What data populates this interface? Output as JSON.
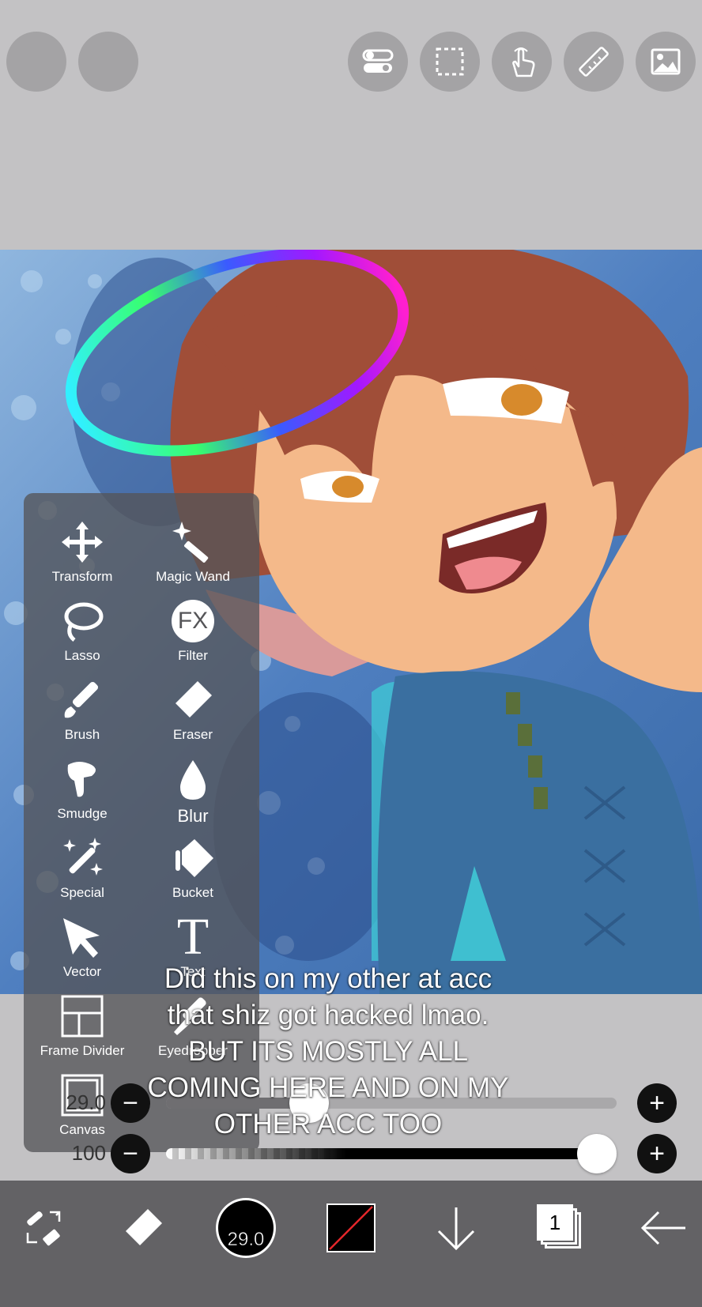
{
  "top_bar": {
    "left_buttons": [
      {
        "icon": "blank-circle-icon"
      },
      {
        "icon": "blank-circle-icon"
      }
    ],
    "right_buttons": [
      {
        "icon": "toggle-settings-icon"
      },
      {
        "icon": "selection-icon"
      },
      {
        "icon": "hand-touch-icon"
      },
      {
        "icon": "ruler-icon"
      },
      {
        "icon": "image-icon"
      }
    ]
  },
  "tool_panel": {
    "tools": [
      {
        "label": "Transform",
        "icon": "transform-icon"
      },
      {
        "label": "Magic Wand",
        "icon": "magic-wand-icon"
      },
      {
        "label": "Lasso",
        "icon": "lasso-icon"
      },
      {
        "label": "Filter",
        "icon": "fx-icon",
        "icon_text": "FX"
      },
      {
        "label": "Brush",
        "icon": "brush-icon"
      },
      {
        "label": "Eraser",
        "icon": "eraser-icon"
      },
      {
        "label": "Smudge",
        "icon": "smudge-icon"
      },
      {
        "label": "Blur",
        "icon": "blur-icon"
      },
      {
        "label": "Special",
        "icon": "special-icon"
      },
      {
        "label": "Bucket",
        "icon": "bucket-icon"
      },
      {
        "label": "Vector",
        "icon": "vector-icon"
      },
      {
        "label": "Text",
        "icon": "text-icon",
        "icon_text": "T"
      },
      {
        "label": "Frame Divider",
        "icon": "frame-divider-icon"
      },
      {
        "label": "Eyedropper",
        "icon": "eyedropper-icon"
      },
      {
        "label": "Canvas",
        "icon": "canvas-icon"
      }
    ]
  },
  "sliders": {
    "size": {
      "value": "29.0",
      "level": 0.3
    },
    "opacity": {
      "value": "100",
      "level": 1.0
    },
    "minus_label": "−",
    "plus_label": "+"
  },
  "caption": {
    "lines": [
      "Did this on my other at acc",
      "that shiz got hacked lmao.",
      "BUT ITS MOSTLY ALL",
      "COMING HERE AND ON MY",
      "OTHER ACC TOO"
    ]
  },
  "bottom_bar": {
    "brush_size": "29.0",
    "layer_count": "1",
    "items": [
      {
        "icon": "tool-swap-icon"
      },
      {
        "icon": "eraser-icon"
      },
      {
        "icon": "brush-size-icon"
      },
      {
        "icon": "color-swatch-icon"
      },
      {
        "icon": "down-arrow-icon"
      },
      {
        "icon": "layers-icon"
      },
      {
        "icon": "back-arrow-icon"
      }
    ]
  },
  "colors": {
    "top_bar_bg": "#c3c2c4",
    "button_bg": "#a4a3a5",
    "panel_bg": "#555558",
    "bottom_bar_bg": "#636265",
    "accent_current_color": "#111111"
  }
}
